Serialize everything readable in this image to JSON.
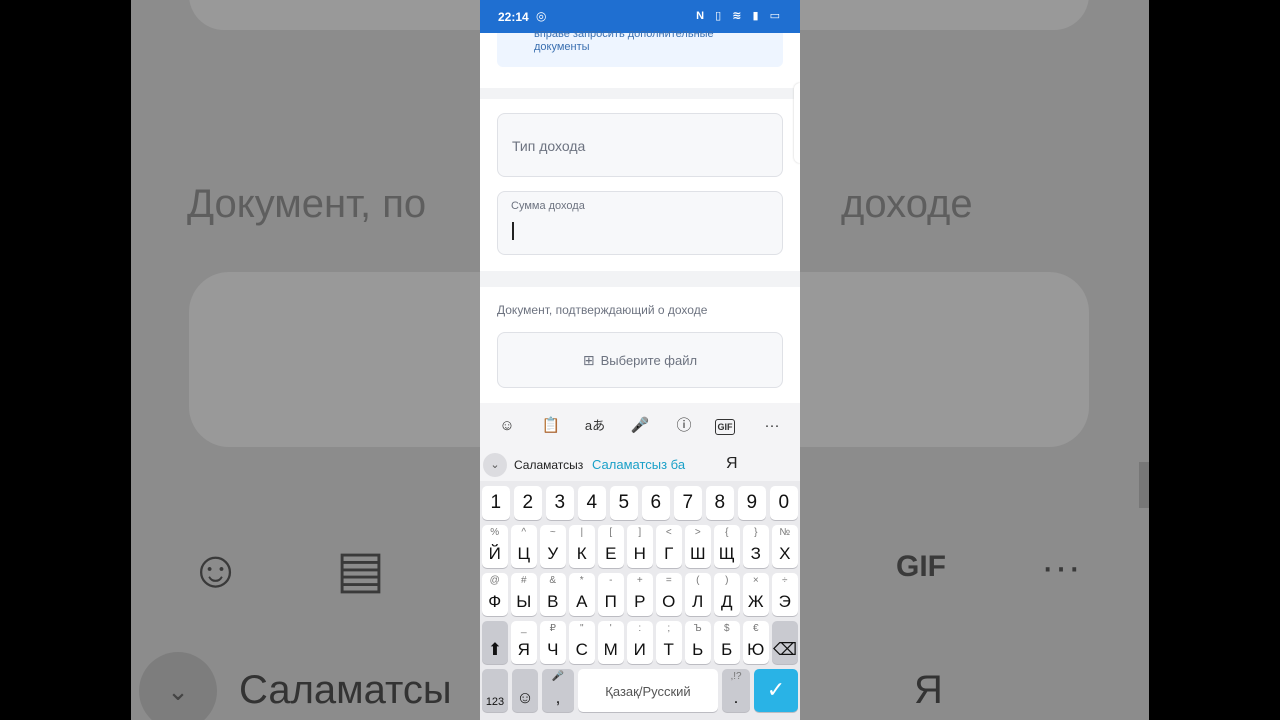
{
  "background": {
    "heading_left": "Документ, по",
    "heading_right": "доходе",
    "suggestion": "Саламатсы",
    "letter": "Я",
    "gif": "GIF",
    "more": "···"
  },
  "status_bar": {
    "time": "22:14",
    "icons": "N ▯ ≋ ▮ ▭"
  },
  "note": {
    "line1": "вправе запросить дополнительные",
    "line2": "документы"
  },
  "form": {
    "income_type_placeholder": "Тип дохода",
    "income_amount_label": "Сумма дохода",
    "income_amount_value": "",
    "document_label": "Документ, подтверждающий о доходе",
    "choose_file_label": "Выберите файл"
  },
  "keyboard": {
    "toolbar": [
      "☺",
      "📋",
      "aあ",
      "🎤",
      "ⓘ",
      "GIF",
      "···"
    ],
    "suggestions": [
      "Саламатсыз",
      "Саламатсыз ба",
      "Я"
    ],
    "number_row": [
      "1",
      "2",
      "3",
      "4",
      "5",
      "6",
      "7",
      "8",
      "9",
      "0"
    ],
    "row1": [
      {
        "s": "%",
        "p": "Й"
      },
      {
        "s": "^",
        "p": "Ц"
      },
      {
        "s": "~",
        "p": "У"
      },
      {
        "s": "|",
        "p": "К"
      },
      {
        "s": "[",
        "p": "Е"
      },
      {
        "s": "]",
        "p": "Н"
      },
      {
        "s": "<",
        "p": "Г"
      },
      {
        "s": ">",
        "p": "Ш"
      },
      {
        "s": "{",
        "p": "Щ"
      },
      {
        "s": "}",
        "p": "З"
      },
      {
        "s": "№",
        "p": "Х"
      }
    ],
    "row2": [
      {
        "s": "@",
        "p": "Ф"
      },
      {
        "s": "#",
        "p": "Ы"
      },
      {
        "s": "&",
        "p": "В"
      },
      {
        "s": "*",
        "p": "А"
      },
      {
        "s": "-",
        "p": "П"
      },
      {
        "s": "+",
        "p": "Р"
      },
      {
        "s": "=",
        "p": "О"
      },
      {
        "s": "(",
        "p": "Л"
      },
      {
        "s": ")",
        "p": "Д"
      },
      {
        "s": "×",
        "p": "Ж"
      },
      {
        "s": "÷",
        "p": "Э"
      }
    ],
    "row3": [
      {
        "s": "_",
        "p": "Я"
      },
      {
        "s": "₽",
        "p": "Ч"
      },
      {
        "s": "\"",
        "p": "С"
      },
      {
        "s": "'",
        "p": "М"
      },
      {
        "s": ":",
        "p": "И"
      },
      {
        "s": ";",
        "p": "Т"
      },
      {
        "s": "Ъ",
        "p": "Ь"
      },
      {
        "s": "$",
        "p": "Б"
      },
      {
        "s": "€",
        "p": "Ю"
      }
    ],
    "shift": "⬆",
    "backspace": "⌫",
    "numbers_label": "123",
    "emoji": "☺",
    "comma_sec": "🎤",
    "comma": ",",
    "space_label": "Қазақ/Русский",
    "period_sec": ",!?",
    "period": ".",
    "enter": "✓"
  }
}
